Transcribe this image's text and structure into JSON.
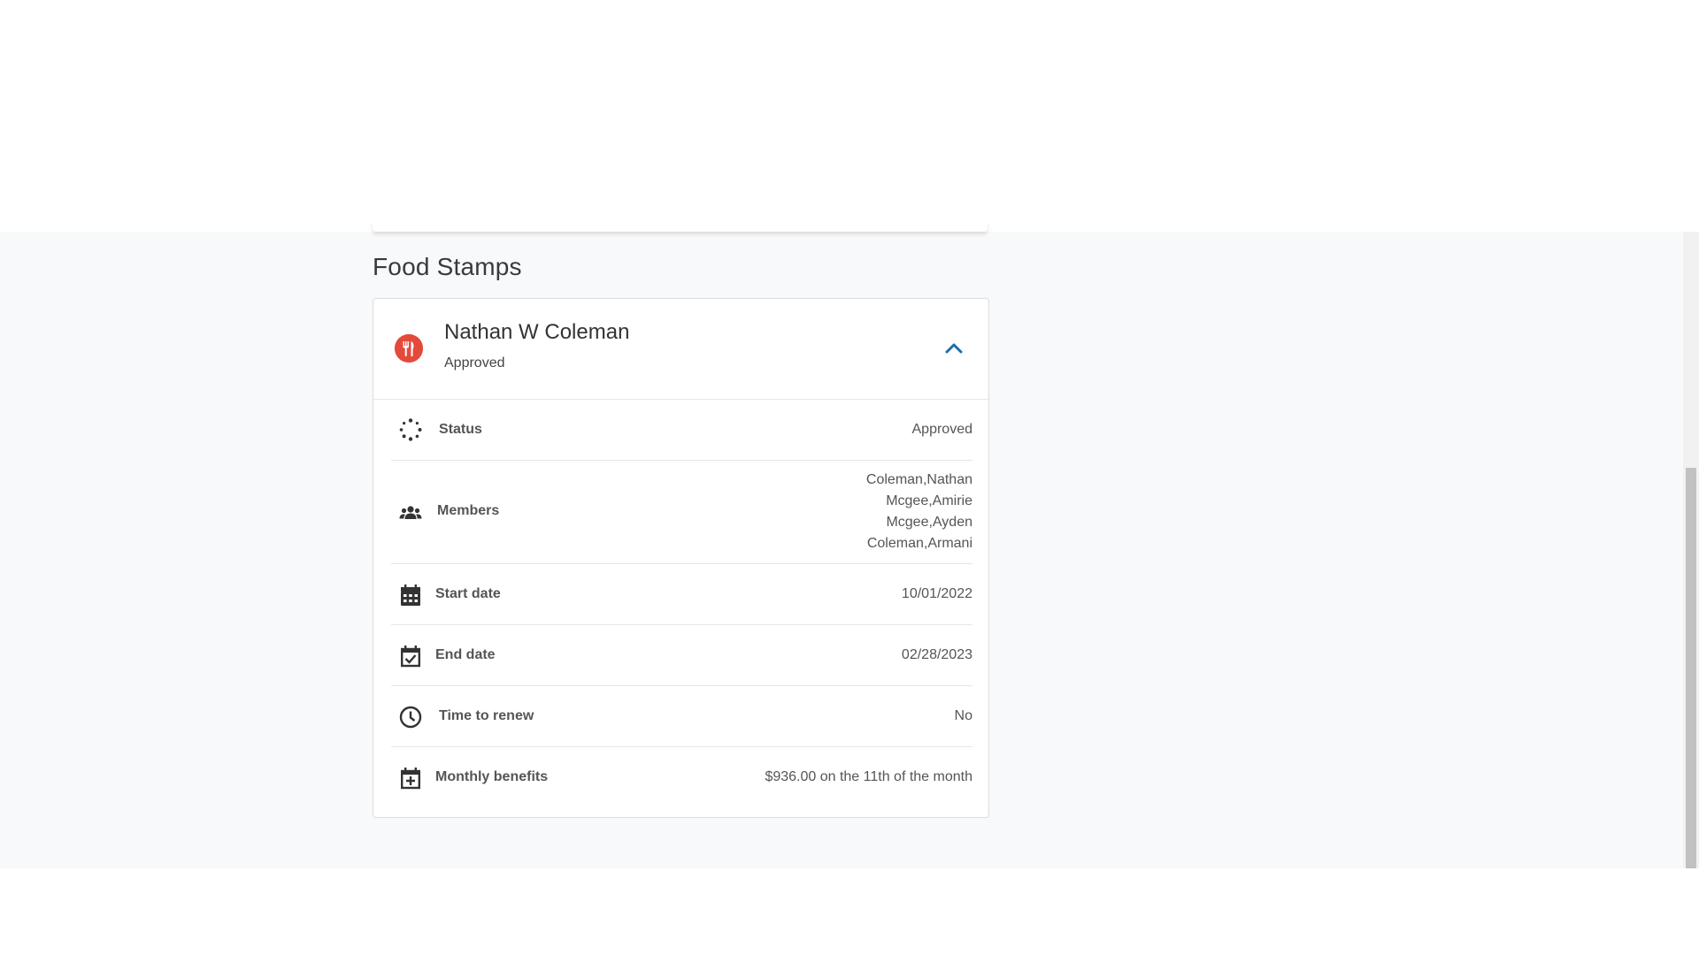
{
  "section": {
    "title": "Food Stamps"
  },
  "card": {
    "name": "Nathan W Coleman",
    "status": "Approved",
    "program_icon": "fork-knife-icon",
    "collapse_icon": "chevron-up-icon",
    "accent_color": "#e44a3a",
    "chevron_color": "#1a6fa8"
  },
  "details": {
    "status": {
      "label": "Status",
      "value": "Approved",
      "icon": "spinner-icon"
    },
    "members": {
      "label": "Members",
      "icon": "people-icon",
      "names": [
        "Coleman,Nathan",
        "Mcgee,Amirie",
        "Mcgee,Ayden",
        "Coleman,Armani"
      ]
    },
    "start_date": {
      "label": "Start date",
      "value": "10/01/2022",
      "icon": "calendar-icon"
    },
    "end_date": {
      "label": "End date",
      "value": "02/28/2023",
      "icon": "calendar-check-icon"
    },
    "time_to_renew": {
      "label": "Time to renew",
      "value": "No",
      "icon": "clock-icon"
    },
    "monthly_benefits": {
      "label": "Monthly benefits",
      "value": "$936.00 on the 11th of the month",
      "icon": "calendar-plus-icon"
    }
  }
}
